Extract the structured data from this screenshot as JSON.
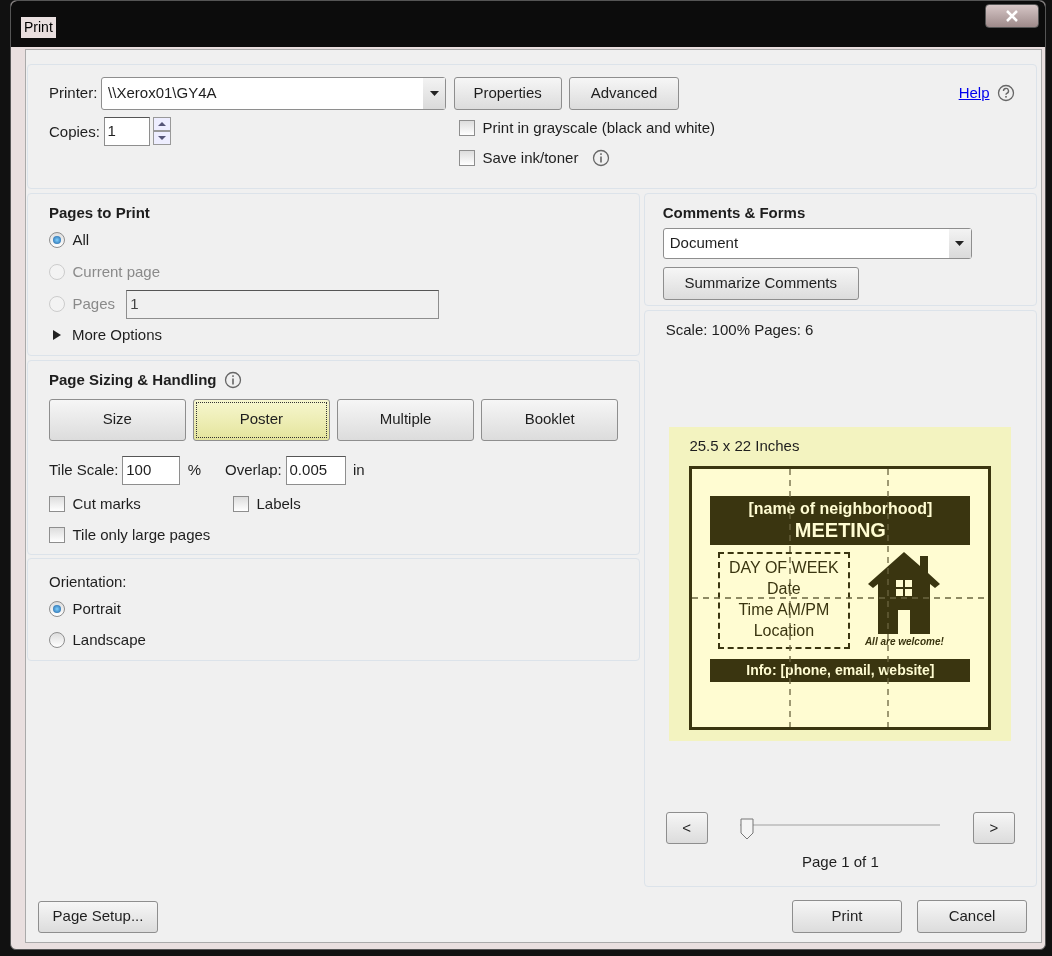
{
  "window": {
    "title": "Print"
  },
  "printer": {
    "label": "Printer:",
    "value": "\\\\Xerox01\\GY4A",
    "buttons": [
      "Properties",
      "Advanced"
    ]
  },
  "help": {
    "label": "Help"
  },
  "copies": {
    "label": "Copies:",
    "value": "1"
  },
  "options": [
    {
      "label": "Print in grayscale (black and white)",
      "checked": false,
      "info": false
    },
    {
      "label": "Save ink/toner",
      "checked": false,
      "info": true
    }
  ],
  "pages_to_print": {
    "title": "Pages to Print",
    "choices": [
      {
        "label": "All",
        "selected": true,
        "disabled": false
      },
      {
        "label": "Current page",
        "selected": false,
        "disabled": true
      },
      {
        "label": "Pages",
        "selected": false,
        "disabled": true,
        "value": "1"
      }
    ],
    "more_options": "More Options",
    "expanded": false
  },
  "page_sizing": {
    "title": "Page Sizing & Handling",
    "modes": [
      {
        "label": "Size",
        "selected": false
      },
      {
        "label": "Poster",
        "selected": true
      },
      {
        "label": "Multiple",
        "selected": false
      },
      {
        "label": "Booklet",
        "selected": false
      }
    ],
    "tile_scale": {
      "label": "Tile Scale:",
      "value": "100",
      "unit": "%"
    },
    "overlap": {
      "label": "Overlap:",
      "value": "0.005",
      "unit": "in"
    },
    "checks": [
      {
        "label": "Cut marks",
        "checked": false
      },
      {
        "label": "Labels",
        "checked": false
      },
      {
        "label": "Tile only large pages",
        "checked": false
      }
    ]
  },
  "orientation": {
    "title": "Orientation:",
    "choices": [
      {
        "label": "Portrait",
        "selected": true
      },
      {
        "label": "Landscape",
        "selected": false
      }
    ]
  },
  "comments_forms": {
    "title": "Comments & Forms",
    "value": "Document",
    "button": "Summarize Comments"
  },
  "preview": {
    "summary": "Scale: 100% Pages: 6",
    "size_label": "25.5 x 22 Inches",
    "poster": {
      "heading": "[name of neighborhood]",
      "subheading": "MEETING",
      "details": [
        "DAY OF WEEK",
        "Date",
        "Time AM/PM",
        "Location"
      ],
      "tagline": "All are welcome!",
      "info": "Info:  [phone, email, website]"
    },
    "prev": "<",
    "next": ">",
    "level": 0,
    "page_label": "Page 1 of 1"
  },
  "footer": {
    "page_setup": "Page Setup...",
    "print": "Print",
    "cancel": "Cancel"
  }
}
